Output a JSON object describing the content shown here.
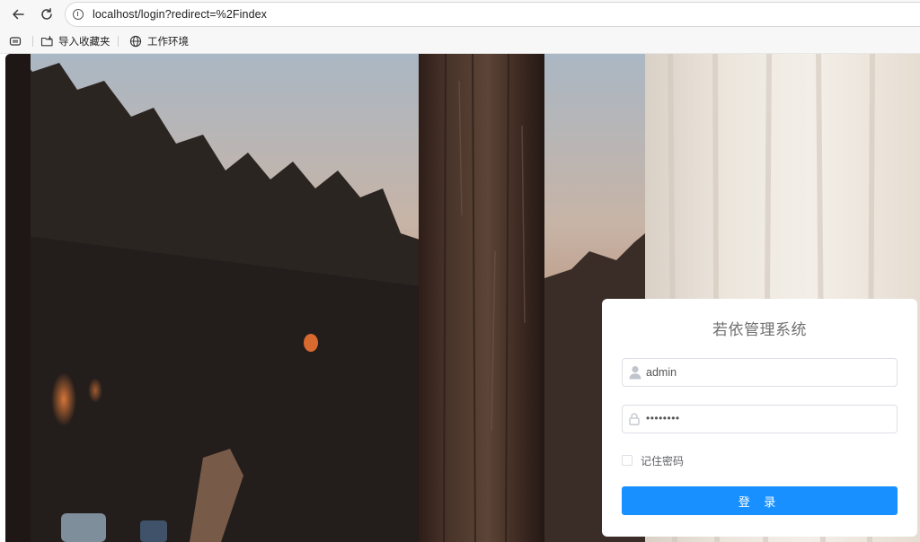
{
  "browser": {
    "url": "localhost/login?redirect=%2Findex",
    "bookmarks": [
      {
        "label": "导入收藏夹"
      },
      {
        "label": "工作环境"
      }
    ]
  },
  "login": {
    "title": "若依管理系统",
    "username": {
      "value": "admin"
    },
    "password": {
      "masked": "••••••••"
    },
    "remember": {
      "label": "记住密码",
      "checked": false
    },
    "submit_label": "登 录"
  },
  "colors": {
    "accent": "#1890ff",
    "card_bg": "#ffffff",
    "title_text": "#707070"
  }
}
